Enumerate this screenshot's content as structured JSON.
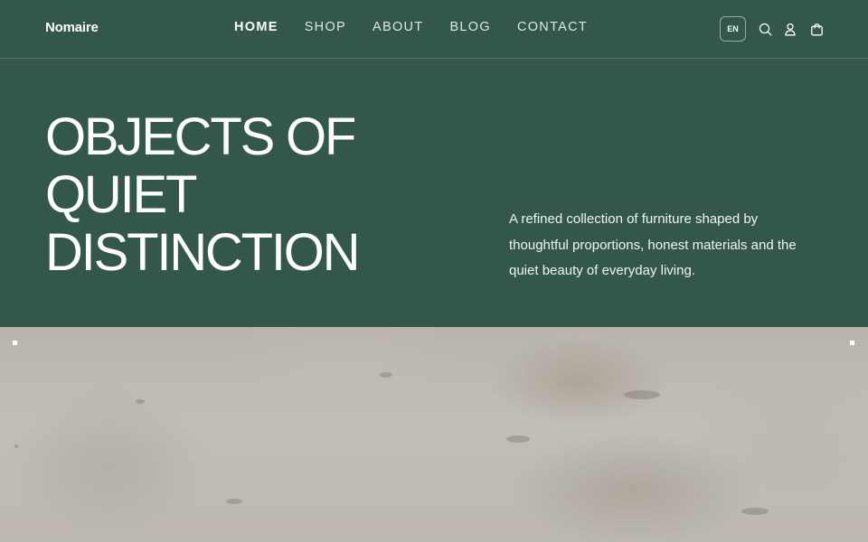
{
  "header": {
    "logo": "Nomaire",
    "nav": [
      {
        "label": "HOME",
        "active": true
      },
      {
        "label": "SHOP",
        "active": false
      },
      {
        "label": "ABOUT",
        "active": false
      },
      {
        "label": "BLOG",
        "active": false
      },
      {
        "label": "CONTACT",
        "active": false
      }
    ],
    "language": "EN",
    "icons": [
      "search-icon",
      "account-icon",
      "cart-icon"
    ]
  },
  "hero": {
    "title_lines": [
      "OBJECTS OF",
      "QUIET",
      "DISTINCTION"
    ],
    "description": "A refined collection of furniture shaped by thoughtful proportions, honest materials and the quiet beauty of everyday living."
  },
  "colors": {
    "background": "#34574b",
    "text": "#ffffff",
    "banner": "#bdb8b0"
  }
}
